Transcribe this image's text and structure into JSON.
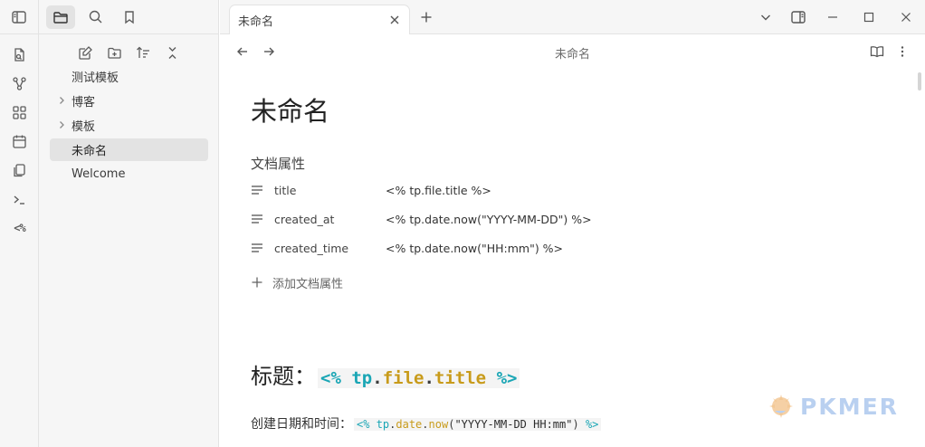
{
  "tab": {
    "title": "未命名"
  },
  "nav": {
    "title": "未命名"
  },
  "ribbon": {
    "templater_label": "<%"
  },
  "sidebar": {
    "items": [
      {
        "label": "测试模板",
        "type": "file"
      },
      {
        "label": "博客",
        "type": "folder"
      },
      {
        "label": "模板",
        "type": "folder"
      },
      {
        "label": "未命名",
        "type": "file",
        "selected": true
      },
      {
        "label": "Welcome",
        "type": "file"
      }
    ]
  },
  "note": {
    "title": "未命名",
    "properties_heading": "文档属性",
    "properties": [
      {
        "key": "title",
        "value": "<% tp.file.title %>"
      },
      {
        "key": "created_at",
        "value": "<% tp.date.now(\"YYYY-MM-DD\") %>"
      },
      {
        "key": "created_time",
        "value": "<% tp.date.now(\"HH:mm\") %>"
      }
    ],
    "add_property": "添加文档属性",
    "heading2_label": "标题：",
    "heading2_code": {
      "open": "<%",
      "obj": "tp",
      "dot1": ".",
      "mod": "file",
      "dot2": ".",
      "fn": "title",
      "close": "%>"
    },
    "line3_label": "创建日期和时间：",
    "line3_code": {
      "open": "<%",
      "obj": "tp",
      "dot1": ".",
      "mod": "date",
      "dot2": ".",
      "fn": "now",
      "paren_open": "(",
      "arg": "\"YYYY-MM-DD HH:mm\"",
      "paren_close": ")",
      "close": "%>"
    }
  },
  "watermark": {
    "text": "PKMER"
  },
  "colors": {
    "code_cyan": "#1aa6b5",
    "code_yellow": "#c89b1b",
    "selected_bg": "#e3e3e3"
  }
}
